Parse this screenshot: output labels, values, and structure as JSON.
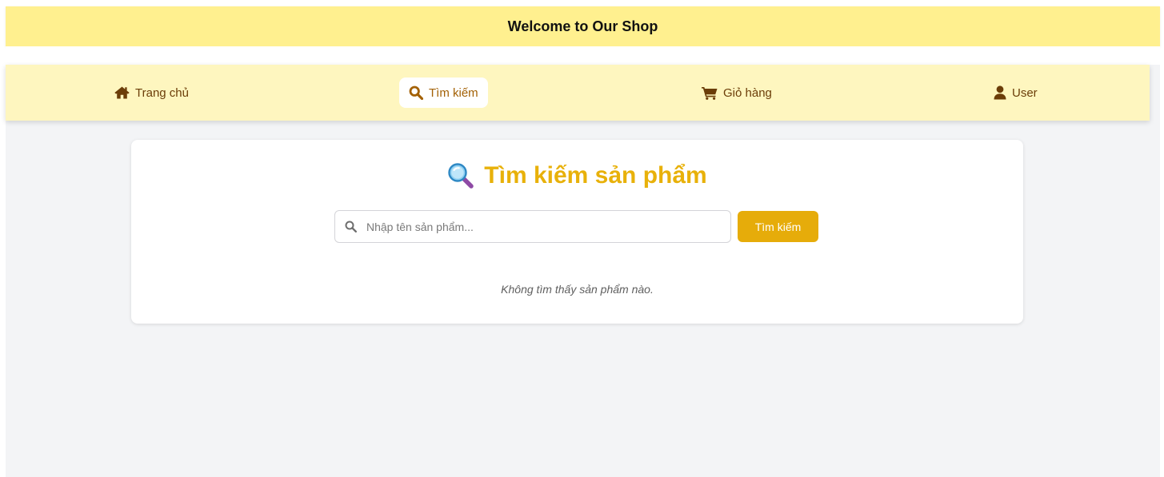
{
  "banner": {
    "title": "Welcome to Our Shop"
  },
  "nav": {
    "items": [
      {
        "label": "Trang chủ",
        "icon": "home-icon",
        "active": false
      },
      {
        "label": "Tìm kiếm",
        "icon": "search-icon",
        "active": true
      },
      {
        "label": "Giỏ hàng",
        "icon": "cart-icon",
        "active": false
      },
      {
        "label": "User",
        "icon": "user-icon",
        "active": false
      }
    ]
  },
  "search_page": {
    "title": "Tìm kiếm sản phẩm",
    "title_icon": "magnifier-emoji-icon",
    "input_placeholder": "Nhập tên sản phẩm...",
    "input_value": "",
    "button_label": "Tìm kiếm",
    "empty_message": "Không tìm thấy sản phẩm nào."
  },
  "colors": {
    "banner_bg": "#fff08f",
    "nav_bg": "#fef6bf",
    "nav_text": "#6b3d08",
    "accent": "#e6ac0a",
    "title": "#e8b10a",
    "page_bg": "#f3f4f6"
  }
}
